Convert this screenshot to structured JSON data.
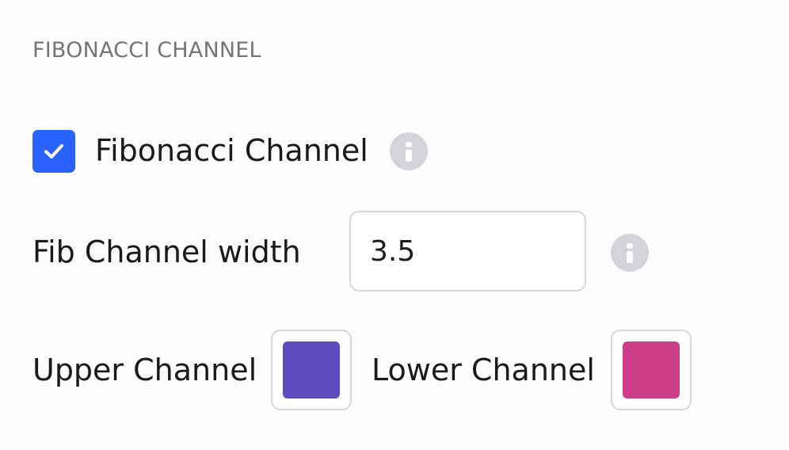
{
  "section": {
    "title": "FIBONACCI CHANNEL"
  },
  "toggle": {
    "label": "Fibonacci Channel",
    "checked": true,
    "accent_color": "#2962ff",
    "info_icon": "info-icon"
  },
  "width_setting": {
    "label": "Fib Channel width",
    "value": "3.5",
    "info_icon": "info-icon"
  },
  "colors": {
    "upper": {
      "label": "Upper Channel",
      "color": "#5e4bbd"
    },
    "lower": {
      "label": "Lower Channel",
      "color": "#cd3f8b"
    }
  }
}
